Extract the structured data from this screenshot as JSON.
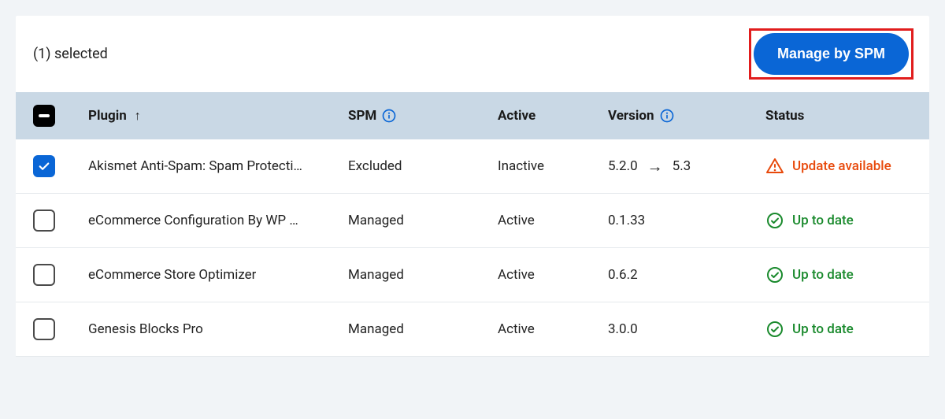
{
  "topbar": {
    "selected_text": "(1) selected",
    "manage_button": "Manage by SPM"
  },
  "columns": {
    "plugin": "Plugin",
    "spm": "SPM",
    "active": "Active",
    "version": "Version",
    "status": "Status"
  },
  "status_labels": {
    "update_available": "Update available",
    "up_to_date": "Up to date"
  },
  "rows": [
    {
      "checked": true,
      "plugin": "Akismet Anti-Spam: Spam Protecti…",
      "spm": "Excluded",
      "active": "Inactive",
      "version_from": "5.2.0",
      "version_to": "5.3",
      "status": "update_available"
    },
    {
      "checked": false,
      "plugin": "eCommerce Configuration By WP …",
      "spm": "Managed",
      "active": "Active",
      "version_from": "0.1.33",
      "version_to": "",
      "status": "up_to_date"
    },
    {
      "checked": false,
      "plugin": "eCommerce Store Optimizer",
      "spm": "Managed",
      "active": "Active",
      "version_from": "0.6.2",
      "version_to": "",
      "status": "up_to_date"
    },
    {
      "checked": false,
      "plugin": "Genesis Blocks Pro",
      "spm": "Managed",
      "active": "Active",
      "version_from": "3.0.0",
      "version_to": "",
      "status": "up_to_date"
    }
  ],
  "colors": {
    "accent": "#0a66d6",
    "warn": "#e8490b",
    "ok": "#1a8a2d",
    "highlight_border": "#e11d1d"
  }
}
